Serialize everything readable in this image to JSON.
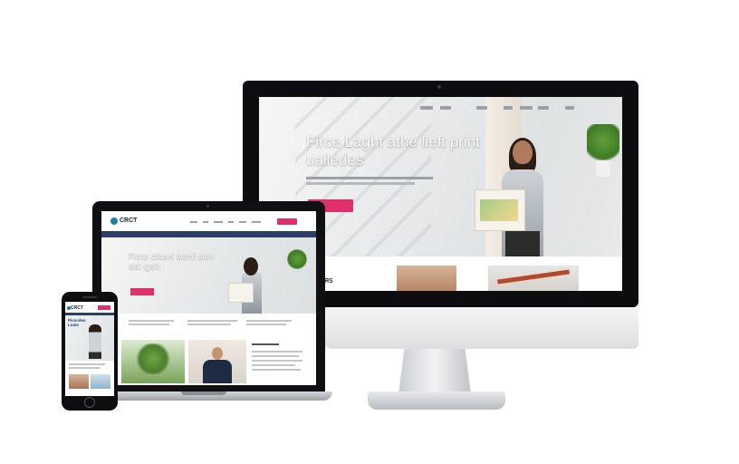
{
  "desktop": {
    "hero_title": "Firce Laght athe lieft print ualledes",
    "nav_items_count_label": "",
    "lower_logo": "ЯS"
  },
  "laptop": {
    "logo": "CRCT",
    "hero_title": "Fiece ctiosel etecfl blert sial tgsiit"
  },
  "phone": {
    "logo": "CRCT",
    "hero_title": "Picscdes Loate"
  },
  "colors": {
    "accent": "#e0306b",
    "navy": "#2c3e66",
    "brand_blue": "#1c7fa8",
    "bezel": "#0d0d0f"
  }
}
